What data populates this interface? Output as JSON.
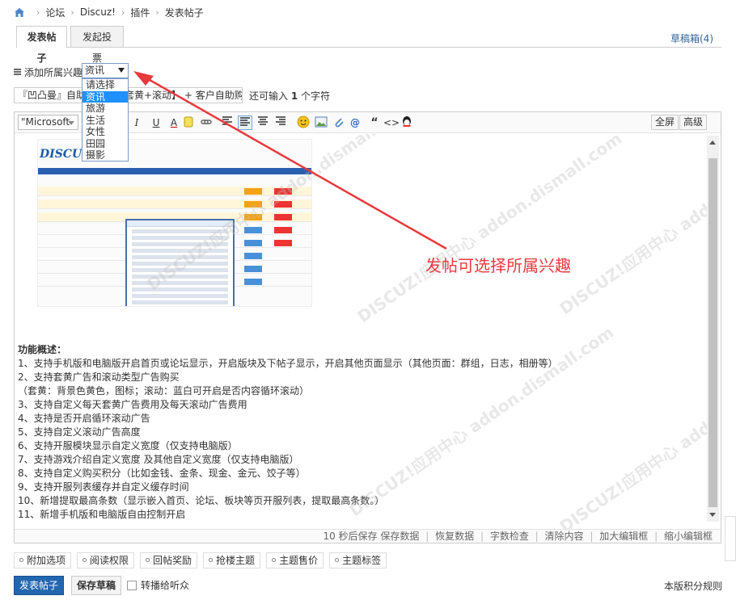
{
  "breadcrumb": {
    "items": [
      "论坛",
      "Discuz!",
      "插件",
      "发表帖子"
    ]
  },
  "tabs": [
    {
      "label": "发表帖子"
    },
    {
      "label": "发起投票"
    }
  ],
  "drafts_link": "草稿箱(4)",
  "interest": {
    "label": "添加所属兴趣",
    "selected": "资讯",
    "options": [
      "请选择",
      "资讯",
      "旅游",
      "生活",
      "女性",
      "田园",
      "摄影"
    ]
  },
  "title": {
    "value": "『凹凸曼』自助广告位【套黄+滚动】 + 客户自助购买，游戏开服表，",
    "remaining_prefix": "还可输入",
    "remaining_count": "1",
    "remaining_suffix": "个字符"
  },
  "toolbar": {
    "font": "\"Microsoft",
    "bold": "B",
    "italic": "I",
    "underline": "U",
    "color": "A",
    "quote": "“",
    "code": "<>",
    "fullscreen": "全屏",
    "advanced": "高级"
  },
  "content": {
    "heading": "功能概述：",
    "lines": [
      "1、支持手机版和电脑版开启首页或论坛显示，开启版块及下帖子显示，开启其他页面显示（其他页面：群组，日志，相册等）",
      "2、支持套黄广告和滚动类型广告购买",
      "（套黄：背景色黄色，图标；滚动：蓝白可开启是否内容循环滚动）",
      "3、支持自定义每天套黄广告费用及每天滚动广告费用",
      "4、支持是否开启循环滚动广告",
      "5、支持自定义滚动广告高度",
      "6、支持开服模块显示自定义宽度（仅支持电脑版）",
      "7、支持游戏介绍自定义宽度 及其他自定义宽度（仅支持电脑版）",
      "8、支持自定义购买积分（比如金钱、金条、现金、金元、饺子等）",
      "9、支持开服列表缓存并自定义缓存时间",
      "10、新增提取最高条数（显示嵌入首页、论坛、板块等页开服列表，提取最高条数。）",
      "11、新增手机版和电脑版自由控制开启"
    ],
    "embedded_logo": "DISCUZ!"
  },
  "statusbar": {
    "autosave": "10 秒后保存",
    "save_data": "保存数据",
    "restore_data": "恢复数据",
    "check_length": "字数检查",
    "clear": "清除内容",
    "enlarge": "加大编辑框",
    "shrink": "缩小编辑框"
  },
  "options": [
    "附加选项",
    "阅读权限",
    "回帖奖励",
    "抢楼主题",
    "主题售价",
    "主题标签"
  ],
  "actions": {
    "submit": "发表帖子",
    "save_draft": "保存草稿",
    "broadcast": "转播给听众",
    "rules": "本版积分规则"
  },
  "annotation": {
    "text": "发帖可选择所属兴趣",
    "color": "#e8393d"
  },
  "watermark": "DISCUZ!应用中心 addon.dismall.com",
  "colors": {
    "primary_button": "#2366b0",
    "selection": "#1e90ff",
    "link": "#336699"
  }
}
